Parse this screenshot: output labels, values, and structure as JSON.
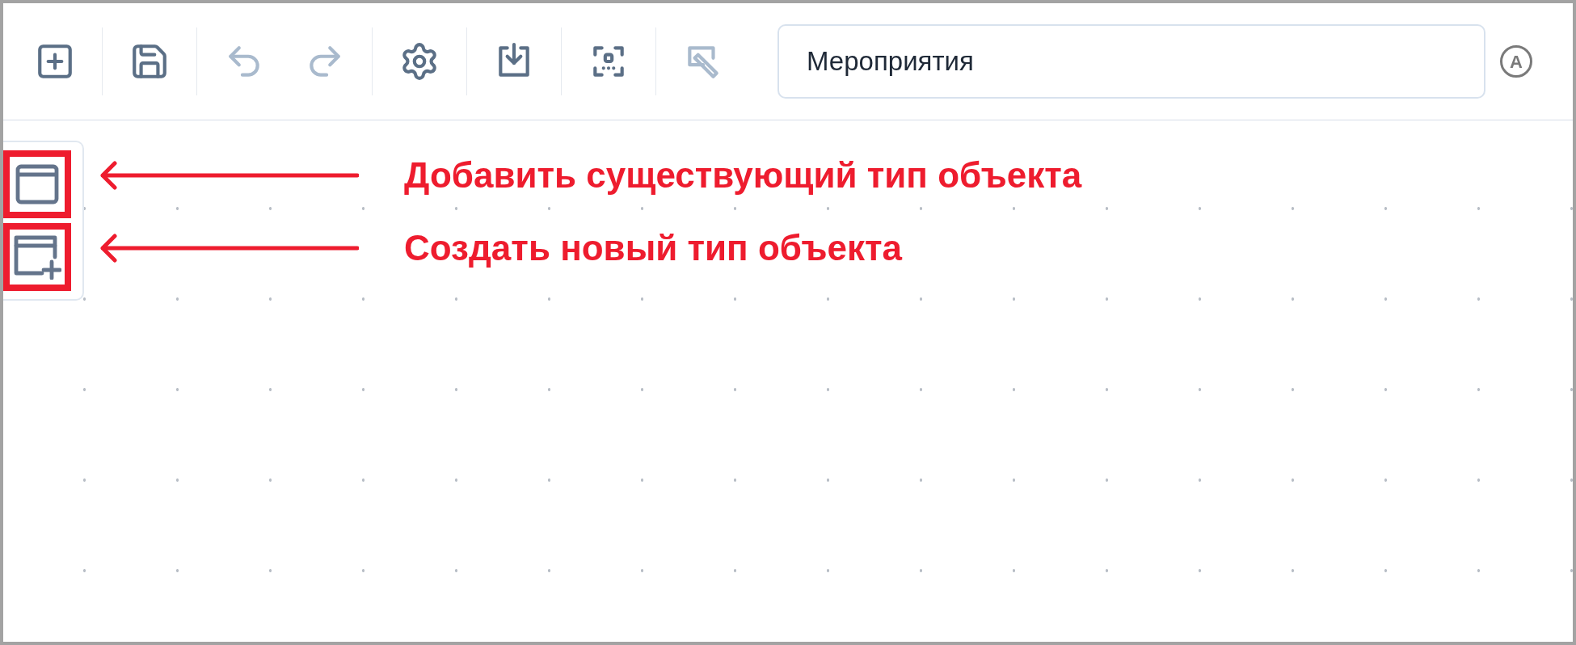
{
  "toolbar": {
    "groups": [
      [
        {
          "kind": "add",
          "disabled": false
        }
      ],
      [
        {
          "kind": "save",
          "disabled": false
        }
      ],
      [
        {
          "kind": "undo",
          "disabled": true
        },
        {
          "kind": "redo",
          "disabled": true
        }
      ],
      [
        {
          "kind": "settings",
          "disabled": false
        }
      ],
      [
        {
          "kind": "import",
          "disabled": false
        }
      ],
      [
        {
          "kind": "scan",
          "disabled": false
        }
      ],
      [
        {
          "kind": "edit",
          "disabled": true
        }
      ]
    ],
    "name_field": {
      "value": "Мероприятия"
    },
    "mode_badge": "A"
  },
  "side_panel": {
    "items": [
      {
        "kind": "existing_type",
        "highlighted": true,
        "annotation": "Добавить существующий тип объекта"
      },
      {
        "kind": "new_type",
        "highlighted": true,
        "annotation": "Создать новый тип объекта"
      }
    ]
  }
}
